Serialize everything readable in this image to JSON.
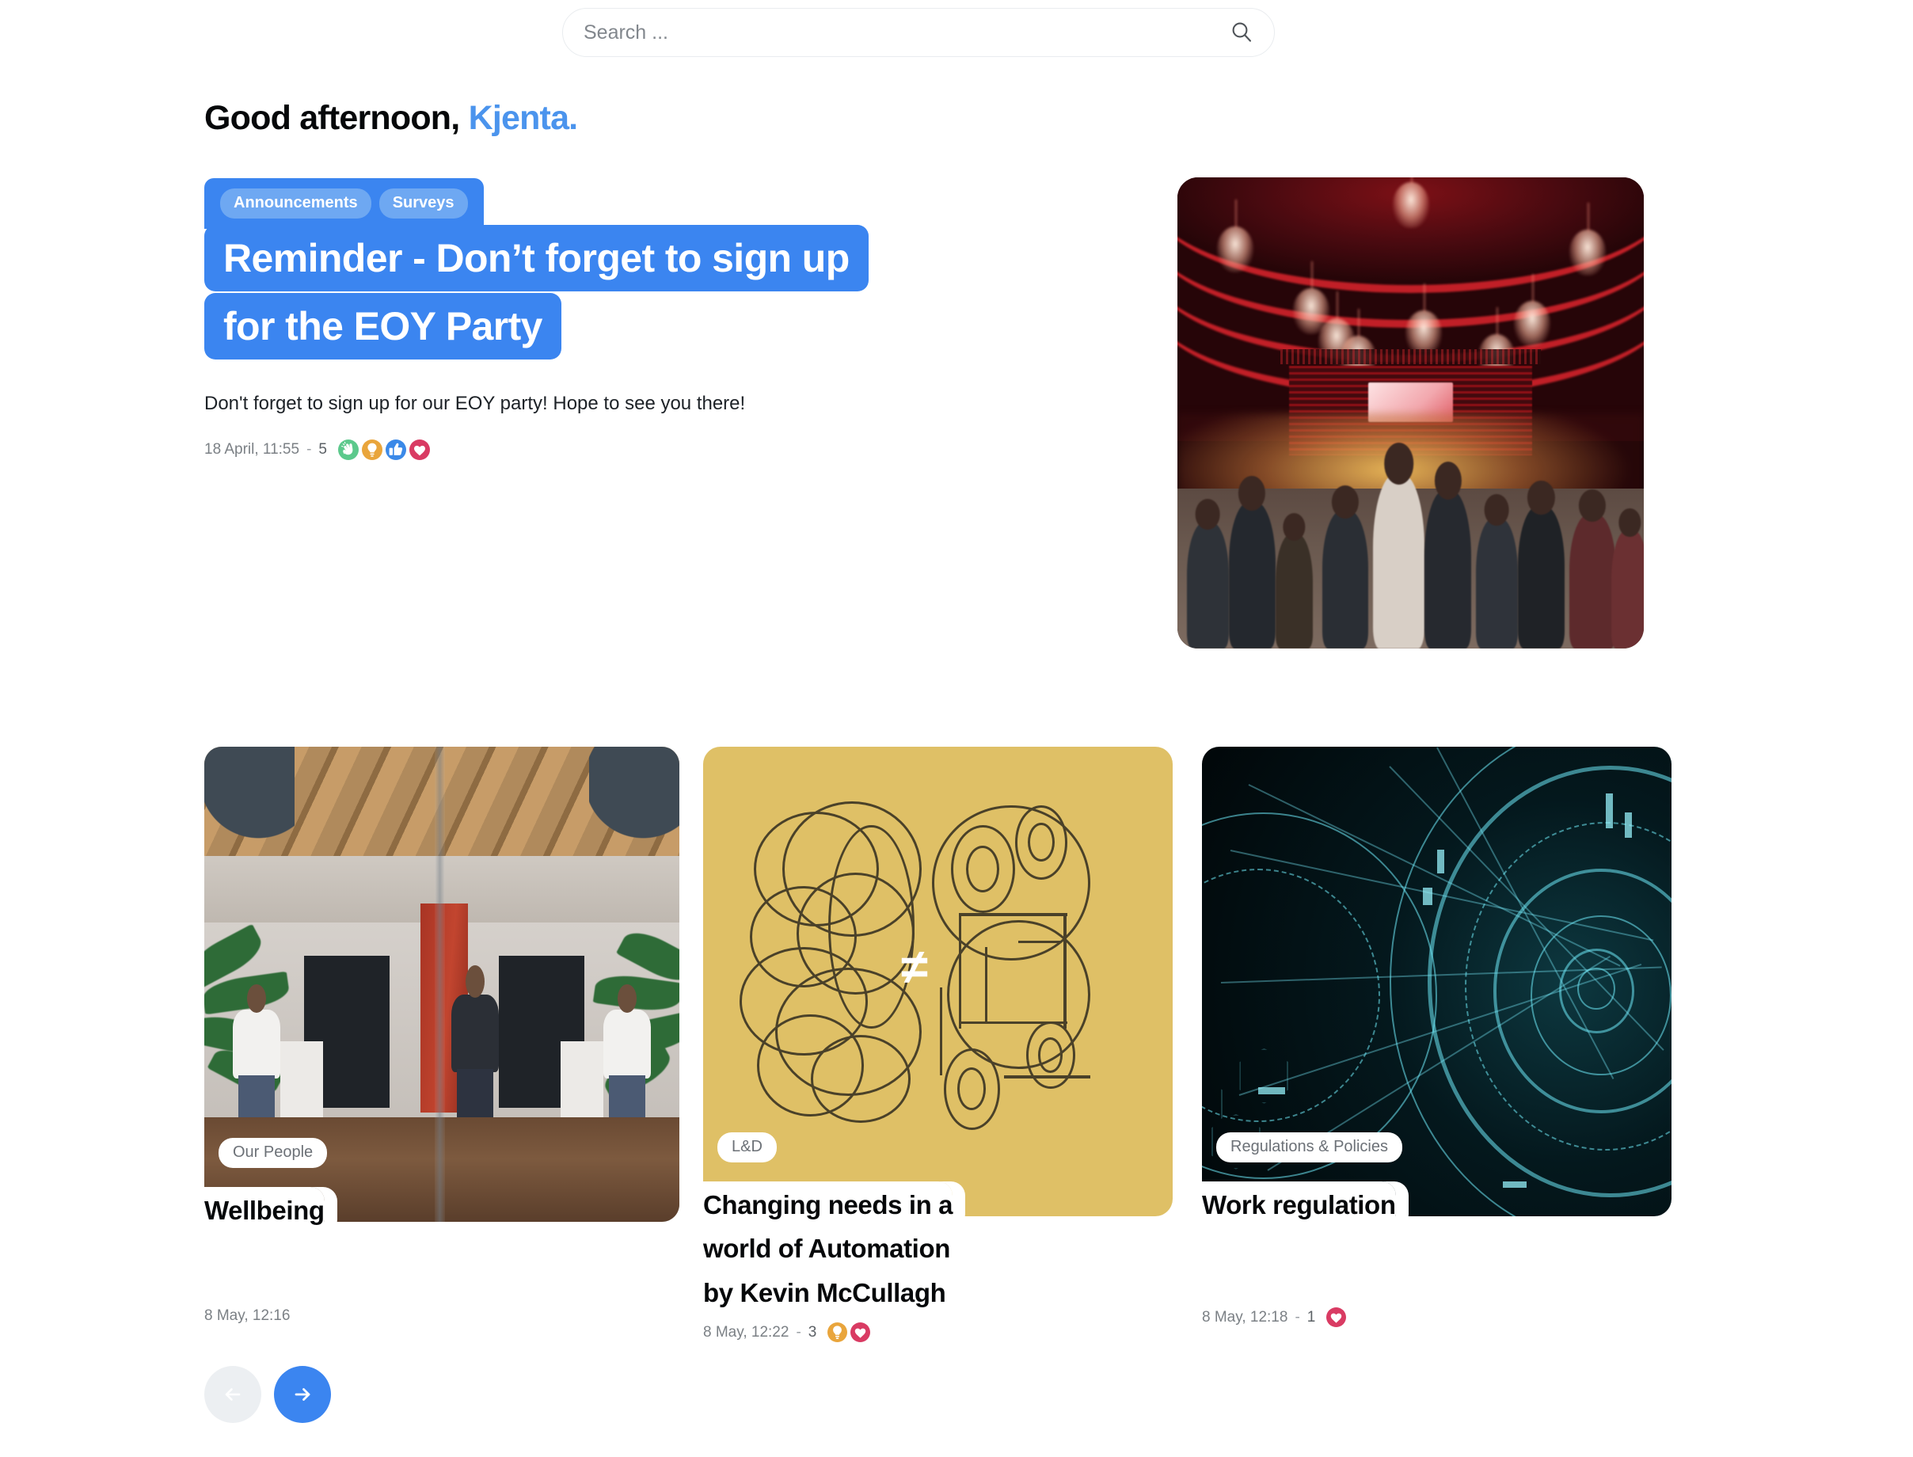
{
  "search": {
    "placeholder": "Search ...",
    "value": "",
    "icon": "search-icon"
  },
  "greeting": {
    "salutation": "Good afternoon,",
    "name": "Kjenta.",
    "name_color": "#4b94ed"
  },
  "hero": {
    "tags": [
      "Announcements",
      "Surveys"
    ],
    "title_lines": [
      "Reminder - Don’t forget to sign up",
      "for the EOY Party"
    ],
    "body": "Don't forget to sign up for our EOY party! Hope to see you there!",
    "date": "18 April, 11:55",
    "separator": "-",
    "reaction_count": "5",
    "reactions": [
      {
        "name": "clap-reaction-icon",
        "color": "#5cc98c"
      },
      {
        "name": "lightbulb-reaction-icon",
        "color": "#e9a53c"
      },
      {
        "name": "thumbs-up-reaction-icon",
        "color": "#3b89e8"
      },
      {
        "name": "heart-reaction-icon",
        "color": "#d93b63"
      }
    ],
    "image_alt": "Crowded event venue with red lighting and chandeliers",
    "accent_color": "#3b85f0",
    "tag_color": "#6ea8f2"
  },
  "cards": [
    {
      "tag": "Our People",
      "title_lines": [
        "Wellbeing"
      ],
      "date": "8 May, 12:16",
      "separator": "",
      "reaction_count": "",
      "reactions": [],
      "image_alt": "Modern office interior with plants and people behind glass"
    },
    {
      "tag": "L&D",
      "title_lines": [
        "Changing needs in a",
        "world of Automation",
        "by Kevin McCullagh"
      ],
      "date": "8 May, 12:22",
      "separator": "-",
      "reaction_count": "3",
      "reactions": [
        {
          "name": "lightbulb-reaction-icon",
          "color": "#e9a53c"
        },
        {
          "name": "heart-reaction-icon",
          "color": "#d93b63"
        }
      ],
      "image_alt": "Illustration of a brain, half organic half mechanical, on mustard background",
      "image_symbol": "≠",
      "image_bg": "#dfc066"
    },
    {
      "tag": "Regulations & Policies",
      "title_lines": [
        "Work regulation"
      ],
      "date": "8 May, 12:18",
      "separator": "-",
      "reaction_count": "1",
      "reactions": [
        {
          "name": "heart-reaction-icon",
          "color": "#d93b63"
        }
      ],
      "image_alt": "Cyan futuristic circular HUD technology graphic on dark background"
    }
  ],
  "pager": {
    "prev_label": "←",
    "next_label": "→",
    "prev_enabled": false,
    "next_enabled": true,
    "prev_bg": "#eceff2",
    "next_bg": "#3b85f0"
  }
}
